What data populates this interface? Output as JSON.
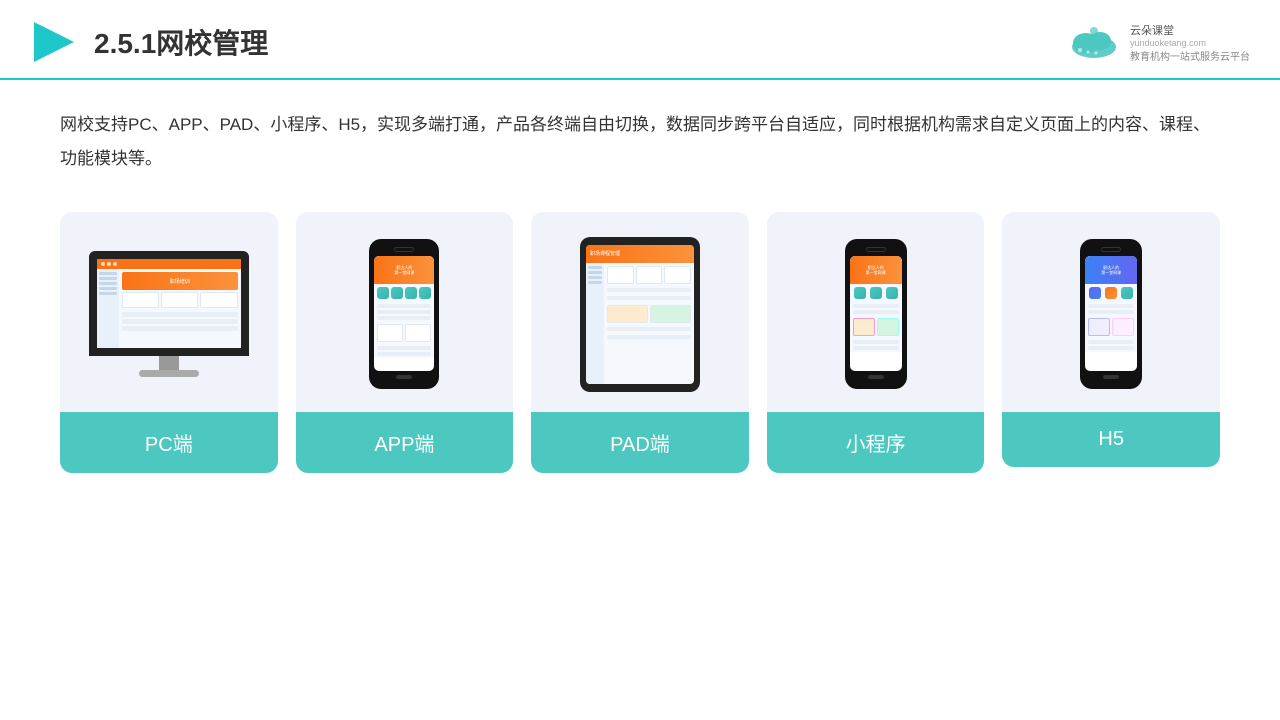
{
  "header": {
    "title": "2.5.1网校管理",
    "logo_name": "云朵课堂",
    "logo_url": "yunduoketang.com",
    "logo_tagline1": "教育机构一站",
    "logo_tagline2": "式服务云平台"
  },
  "description": "网校支持PC、APP、PAD、小程序、H5，实现多端打通，产品各终端自由切换，数据同步跨平台自适应，同时根据机构需求自定义页面上的内容、课程、功能模块等。",
  "cards": [
    {
      "id": "pc",
      "label": "PC端"
    },
    {
      "id": "app",
      "label": "APP端"
    },
    {
      "id": "pad",
      "label": "PAD端"
    },
    {
      "id": "miniapp",
      "label": "小程序"
    },
    {
      "id": "h5",
      "label": "H5"
    }
  ],
  "colors": {
    "teal": "#4dc8c0",
    "accent": "#f97316",
    "bg_card": "#f0f4fa",
    "border_bottom": "#1ec8c8"
  }
}
